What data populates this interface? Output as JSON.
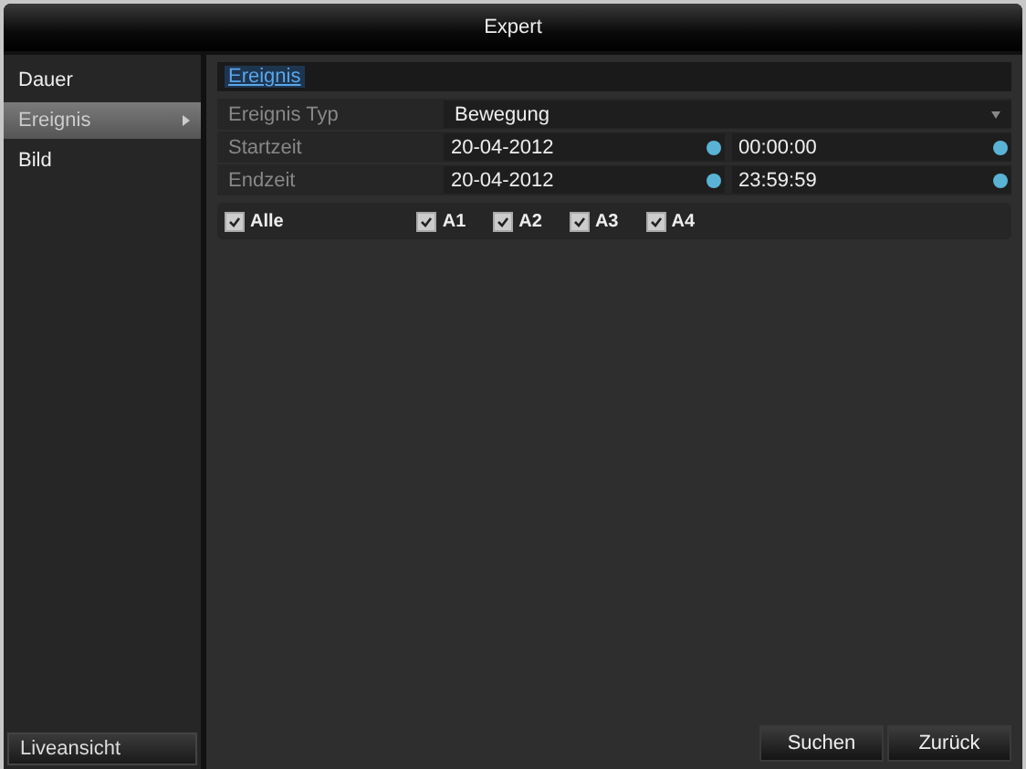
{
  "window": {
    "title": "Expert"
  },
  "sidebar": {
    "items": [
      {
        "label": "Dauer",
        "selected": false
      },
      {
        "label": "Ereignis",
        "selected": true
      },
      {
        "label": "Bild",
        "selected": false
      }
    ],
    "bottom_button": "Liveansicht"
  },
  "tabs": [
    {
      "label": "Ereignis",
      "selected": true
    }
  ],
  "form": {
    "rows": [
      {
        "kind": "dropdown",
        "label": "Ereignis Typ",
        "value": "Bewegung"
      },
      {
        "kind": "datetime",
        "label": "Startzeit",
        "date": "20-04-2012",
        "time": "00:00:00"
      },
      {
        "kind": "datetime",
        "label": "Endzeit",
        "date": "20-04-2012",
        "time": "23:59:59"
      }
    ]
  },
  "channels": [
    {
      "label": "Alle",
      "checked": true
    },
    {
      "label": "A1",
      "checked": true
    },
    {
      "label": "A2",
      "checked": true
    },
    {
      "label": "A3",
      "checked": true
    },
    {
      "label": "A4",
      "checked": true
    }
  ],
  "buttons": [
    "Suchen",
    "Zurück"
  ]
}
